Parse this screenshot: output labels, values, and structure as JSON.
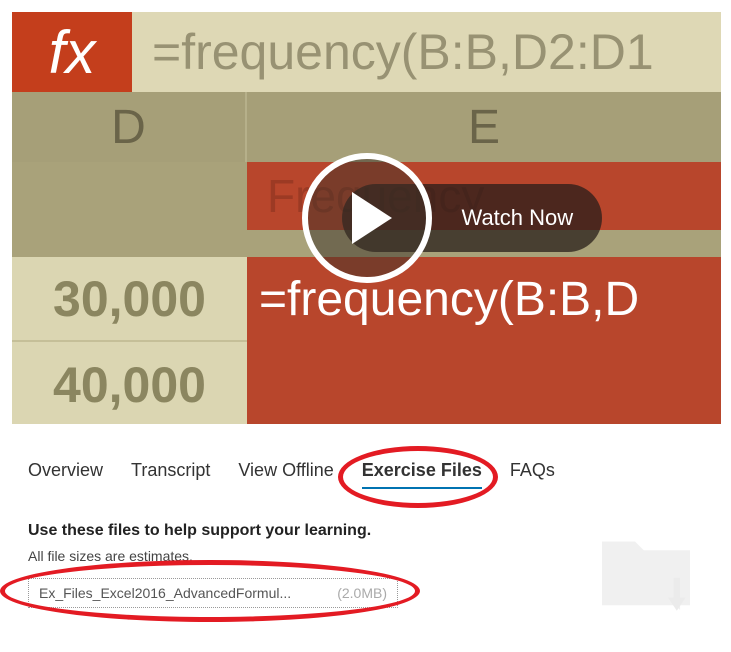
{
  "video": {
    "watch_label": "Watch Now",
    "background": {
      "fx_label": "fx",
      "formula_top": "=frequency(B:B,D2:D1",
      "col_d": "D",
      "col_e": "E",
      "freq_header": "Frequency",
      "val_30": "30,000",
      "val_40": "40,000",
      "formula_row": "=frequency(B:B,D"
    }
  },
  "tabs": {
    "overview": "Overview",
    "transcript": "Transcript",
    "view_offline": "View Offline",
    "exercise_files": "Exercise Files",
    "faqs": "FAQs"
  },
  "content": {
    "heading": "Use these files to help support your learning.",
    "subtext": "All file sizes are estimates.",
    "file_name": "Ex_Files_Excel2016_AdvancedFormul...",
    "file_size": "(2.0MB)"
  }
}
